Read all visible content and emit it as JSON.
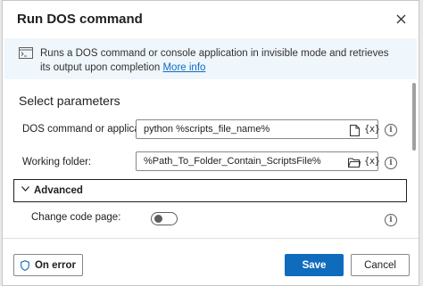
{
  "dialog": {
    "title": "Run DOS command"
  },
  "info": {
    "description": "Runs a DOS command or console application in invisible mode and retrieves its output upon completion",
    "more_info": "More info"
  },
  "parameters": {
    "section_title": "Select parameters",
    "command": {
      "label": "DOS command or application:",
      "value": "python %scripts_file_name%"
    },
    "working_folder": {
      "label": "Working folder:",
      "value": "%Path_To_Folder_Contain_ScriptsFile%"
    },
    "variable_button": "{x}",
    "help_glyph": "i"
  },
  "advanced": {
    "label": "Advanced",
    "expanded": true,
    "change_code_page": {
      "label": "Change code page:",
      "enabled": false
    }
  },
  "footer": {
    "on_error_label": "On error",
    "save_label": "Save",
    "cancel_label": "Cancel"
  },
  "colors": {
    "accent": "#0f6cbd",
    "banner_background": "#eff6fc"
  },
  "icons": {
    "close": "close-icon",
    "banner": "console-window-icon",
    "file_picker": "file-icon",
    "folder_picker": "folder-icon",
    "variables": "variable-icon",
    "help": "info-icon",
    "expand": "chevron-down-icon",
    "on_error": "shield-icon"
  }
}
